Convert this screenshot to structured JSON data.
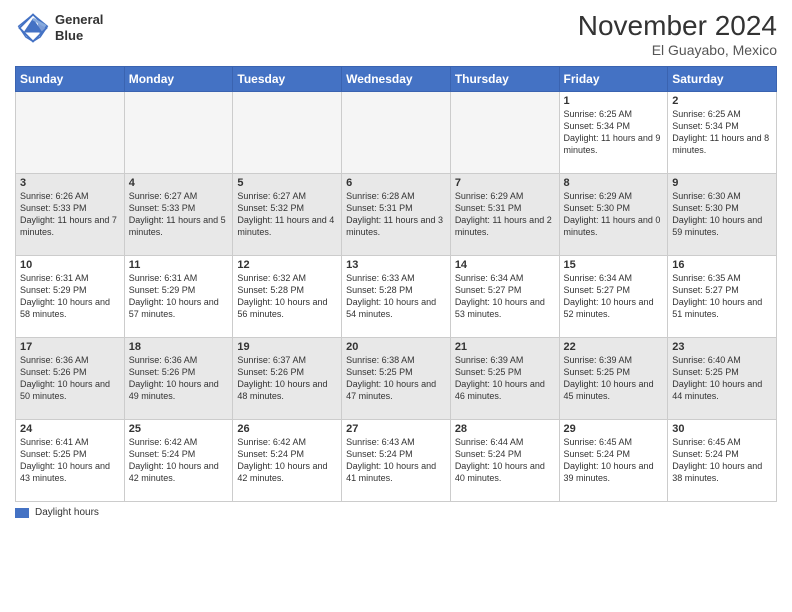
{
  "header": {
    "logo_line1": "General",
    "logo_line2": "Blue",
    "month": "November 2024",
    "location": "El Guayabo, Mexico"
  },
  "days_of_week": [
    "Sunday",
    "Monday",
    "Tuesday",
    "Wednesday",
    "Thursday",
    "Friday",
    "Saturday"
  ],
  "legend": {
    "label": "Daylight hours"
  },
  "weeks": [
    {
      "row_class": "row-odd",
      "days": [
        {
          "num": "",
          "info": "",
          "empty": true
        },
        {
          "num": "",
          "info": "",
          "empty": true
        },
        {
          "num": "",
          "info": "",
          "empty": true
        },
        {
          "num": "",
          "info": "",
          "empty": true
        },
        {
          "num": "",
          "info": "",
          "empty": true
        },
        {
          "num": "1",
          "info": "Sunrise: 6:25 AM\nSunset: 5:34 PM\nDaylight: 11 hours and 9 minutes.",
          "empty": false
        },
        {
          "num": "2",
          "info": "Sunrise: 6:25 AM\nSunset: 5:34 PM\nDaylight: 11 hours and 8 minutes.",
          "empty": false
        }
      ]
    },
    {
      "row_class": "row-even",
      "days": [
        {
          "num": "3",
          "info": "Sunrise: 6:26 AM\nSunset: 5:33 PM\nDaylight: 11 hours and 7 minutes.",
          "empty": false
        },
        {
          "num": "4",
          "info": "Sunrise: 6:27 AM\nSunset: 5:33 PM\nDaylight: 11 hours and 5 minutes.",
          "empty": false
        },
        {
          "num": "5",
          "info": "Sunrise: 6:27 AM\nSunset: 5:32 PM\nDaylight: 11 hours and 4 minutes.",
          "empty": false
        },
        {
          "num": "6",
          "info": "Sunrise: 6:28 AM\nSunset: 5:31 PM\nDaylight: 11 hours and 3 minutes.",
          "empty": false
        },
        {
          "num": "7",
          "info": "Sunrise: 6:29 AM\nSunset: 5:31 PM\nDaylight: 11 hours and 2 minutes.",
          "empty": false
        },
        {
          "num": "8",
          "info": "Sunrise: 6:29 AM\nSunset: 5:30 PM\nDaylight: 11 hours and 0 minutes.",
          "empty": false
        },
        {
          "num": "9",
          "info": "Sunrise: 6:30 AM\nSunset: 5:30 PM\nDaylight: 10 hours and 59 minutes.",
          "empty": false
        }
      ]
    },
    {
      "row_class": "row-odd",
      "days": [
        {
          "num": "10",
          "info": "Sunrise: 6:31 AM\nSunset: 5:29 PM\nDaylight: 10 hours and 58 minutes.",
          "empty": false
        },
        {
          "num": "11",
          "info": "Sunrise: 6:31 AM\nSunset: 5:29 PM\nDaylight: 10 hours and 57 minutes.",
          "empty": false
        },
        {
          "num": "12",
          "info": "Sunrise: 6:32 AM\nSunset: 5:28 PM\nDaylight: 10 hours and 56 minutes.",
          "empty": false
        },
        {
          "num": "13",
          "info": "Sunrise: 6:33 AM\nSunset: 5:28 PM\nDaylight: 10 hours and 54 minutes.",
          "empty": false
        },
        {
          "num": "14",
          "info": "Sunrise: 6:34 AM\nSunset: 5:27 PM\nDaylight: 10 hours and 53 minutes.",
          "empty": false
        },
        {
          "num": "15",
          "info": "Sunrise: 6:34 AM\nSunset: 5:27 PM\nDaylight: 10 hours and 52 minutes.",
          "empty": false
        },
        {
          "num": "16",
          "info": "Sunrise: 6:35 AM\nSunset: 5:27 PM\nDaylight: 10 hours and 51 minutes.",
          "empty": false
        }
      ]
    },
    {
      "row_class": "row-even",
      "days": [
        {
          "num": "17",
          "info": "Sunrise: 6:36 AM\nSunset: 5:26 PM\nDaylight: 10 hours and 50 minutes.",
          "empty": false
        },
        {
          "num": "18",
          "info": "Sunrise: 6:36 AM\nSunset: 5:26 PM\nDaylight: 10 hours and 49 minutes.",
          "empty": false
        },
        {
          "num": "19",
          "info": "Sunrise: 6:37 AM\nSunset: 5:26 PM\nDaylight: 10 hours and 48 minutes.",
          "empty": false
        },
        {
          "num": "20",
          "info": "Sunrise: 6:38 AM\nSunset: 5:25 PM\nDaylight: 10 hours and 47 minutes.",
          "empty": false
        },
        {
          "num": "21",
          "info": "Sunrise: 6:39 AM\nSunset: 5:25 PM\nDaylight: 10 hours and 46 minutes.",
          "empty": false
        },
        {
          "num": "22",
          "info": "Sunrise: 6:39 AM\nSunset: 5:25 PM\nDaylight: 10 hours and 45 minutes.",
          "empty": false
        },
        {
          "num": "23",
          "info": "Sunrise: 6:40 AM\nSunset: 5:25 PM\nDaylight: 10 hours and 44 minutes.",
          "empty": false
        }
      ]
    },
    {
      "row_class": "row-odd",
      "days": [
        {
          "num": "24",
          "info": "Sunrise: 6:41 AM\nSunset: 5:25 PM\nDaylight: 10 hours and 43 minutes.",
          "empty": false
        },
        {
          "num": "25",
          "info": "Sunrise: 6:42 AM\nSunset: 5:24 PM\nDaylight: 10 hours and 42 minutes.",
          "empty": false
        },
        {
          "num": "26",
          "info": "Sunrise: 6:42 AM\nSunset: 5:24 PM\nDaylight: 10 hours and 42 minutes.",
          "empty": false
        },
        {
          "num": "27",
          "info": "Sunrise: 6:43 AM\nSunset: 5:24 PM\nDaylight: 10 hours and 41 minutes.",
          "empty": false
        },
        {
          "num": "28",
          "info": "Sunrise: 6:44 AM\nSunset: 5:24 PM\nDaylight: 10 hours and 40 minutes.",
          "empty": false
        },
        {
          "num": "29",
          "info": "Sunrise: 6:45 AM\nSunset: 5:24 PM\nDaylight: 10 hours and 39 minutes.",
          "empty": false
        },
        {
          "num": "30",
          "info": "Sunrise: 6:45 AM\nSunset: 5:24 PM\nDaylight: 10 hours and 38 minutes.",
          "empty": false
        }
      ]
    }
  ]
}
